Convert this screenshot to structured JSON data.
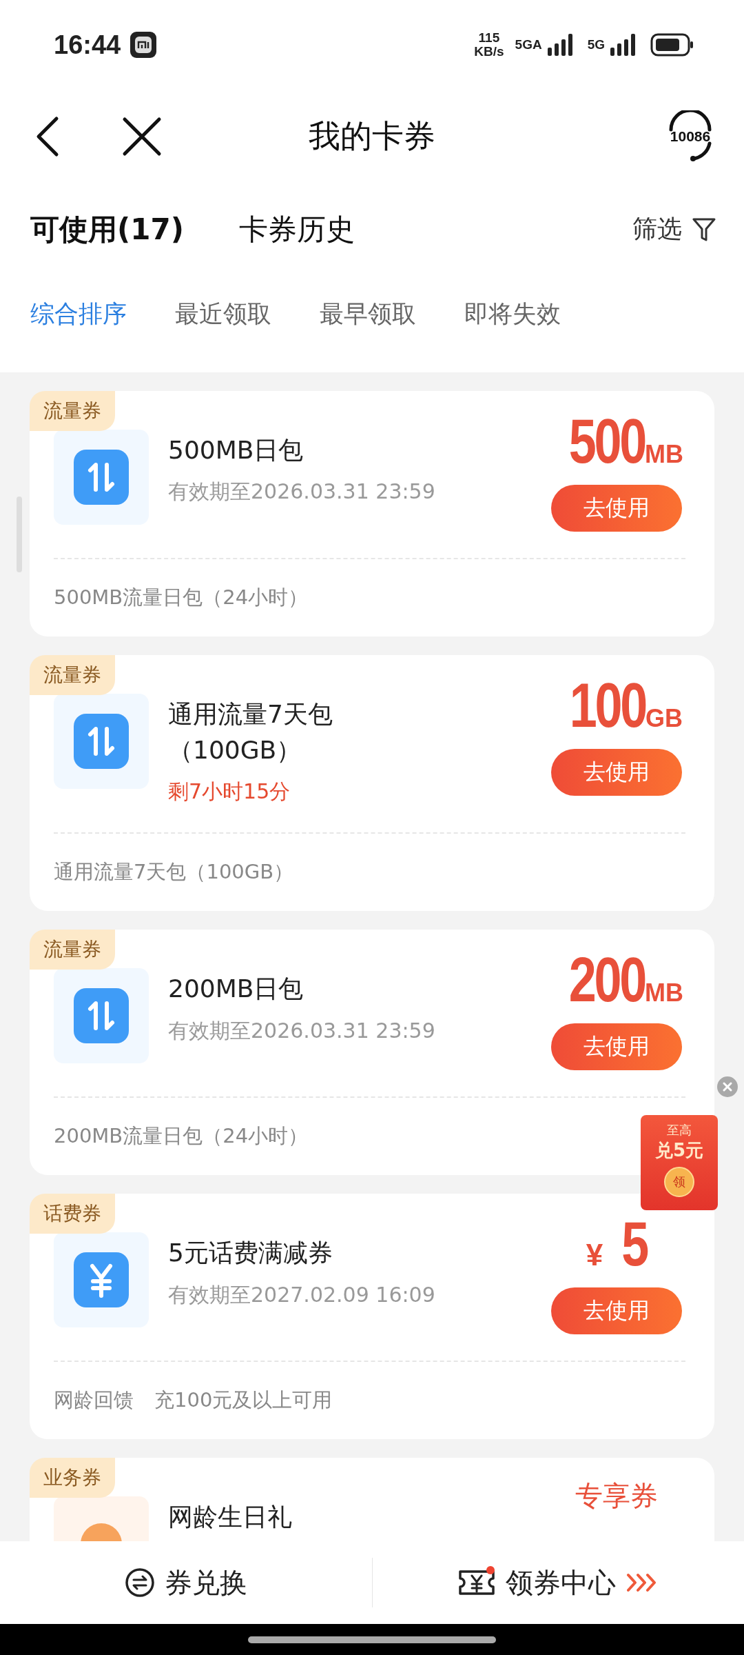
{
  "status_bar": {
    "time": "16:44",
    "speed_value": "115",
    "speed_unit": "KB/s",
    "network_1": "5GA",
    "network_2": "5G"
  },
  "header": {
    "title": "我的卡券",
    "service_number": "10086"
  },
  "tabs": [
    {
      "label": "可使用(17)",
      "selected": true
    },
    {
      "label": "卡券历史",
      "selected": false
    }
  ],
  "filter": {
    "label": "筛选"
  },
  "sort_options": [
    {
      "label": "综合排序",
      "selected": true
    },
    {
      "label": "最近领取",
      "selected": false
    },
    {
      "label": "最早领取",
      "selected": false
    },
    {
      "label": "即将失效",
      "selected": false
    }
  ],
  "coupons": [
    {
      "kind": "data",
      "tag": "流量券",
      "title": "500MB日包",
      "validity": "有效期至2026.03.31 23:59",
      "value": "500",
      "unit": "MB",
      "button": "去使用",
      "footer": [
        "500MB流量日包（24小时）"
      ]
    },
    {
      "kind": "data",
      "tag": "流量券",
      "title": "通用流量7天包（100GB）",
      "remaining_time": "剩7小时15分",
      "value": "100",
      "unit": "GB",
      "button": "去使用",
      "footer": [
        "通用流量7天包（100GB）"
      ]
    },
    {
      "kind": "data",
      "tag": "流量券",
      "title": "200MB日包",
      "validity": "有效期至2026.03.31 23:59",
      "value": "200",
      "unit": "MB",
      "button": "去使用",
      "footer": [
        "200MB流量日包（24小时）"
      ]
    },
    {
      "kind": "bill",
      "tag": "话费券",
      "title": "5元话费满减券",
      "validity": "有效期至2027.02.09 16:09",
      "currency": "¥",
      "value": "5",
      "button": "去使用",
      "footer": [
        "网龄回馈",
        "充100元及以上可用"
      ]
    },
    {
      "kind": "service",
      "tag": "业务券",
      "title": "网龄生日礼",
      "label": "专享券"
    }
  ],
  "promo": {
    "line_1": "至高",
    "line_2": "兑5元",
    "seal": "领"
  },
  "bottom_bar": {
    "exchange": "券兑换",
    "center": "领券中心"
  }
}
